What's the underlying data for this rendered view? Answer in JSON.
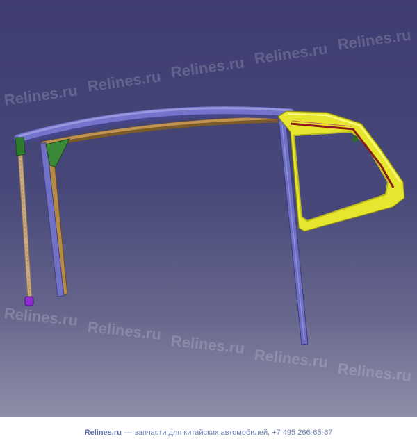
{
  "watermark": {
    "text": "Relines.ru"
  },
  "footer": {
    "site": "Relines.ru",
    "separator": "—",
    "tagline": "запчасти для китайских автомобилей, +7 495 266-65-67"
  },
  "colors": {
    "background_top": "#3f3d72",
    "background_bottom": "#8e8ea8",
    "roof_rail": "#7272c8",
    "inner_rail": "#b48a46",
    "quarter_window_frame": "#e6e62e",
    "seal_strip": "#8b1a1a",
    "bracket": "#3a8a3a",
    "clip": "#8a2ad0"
  },
  "icons": [
    "door-frame-part-diagram"
  ]
}
